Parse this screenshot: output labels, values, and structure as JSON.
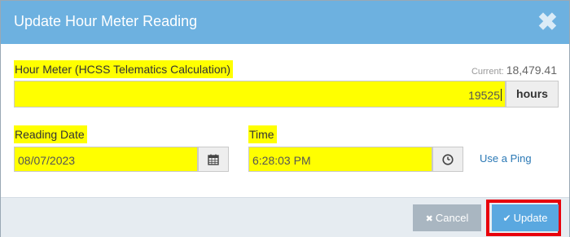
{
  "dialog": {
    "title": "Update Hour Meter Reading",
    "close_glyph": "✖"
  },
  "hour_meter": {
    "label": "Hour Meter (HCSS Telematics Calculation)",
    "current_label": "Current:",
    "current_value": "18,479.41",
    "value": "19525",
    "unit": "hours"
  },
  "reading_date": {
    "label": "Reading Date",
    "value": "08/07/2023",
    "icon": "calendar-icon"
  },
  "time": {
    "label": "Time",
    "value": "6:28:03 PM",
    "icon": "clock-icon",
    "ping_link": "Use a Ping"
  },
  "footer": {
    "cancel_label": "Cancel",
    "update_label": "Update"
  },
  "colors": {
    "header": "#6db1e0",
    "highlight": "#ffff00",
    "update_button": "#5aa8e0",
    "cancel_button": "#a9b6c1",
    "focus_outline": "#e8000b"
  }
}
